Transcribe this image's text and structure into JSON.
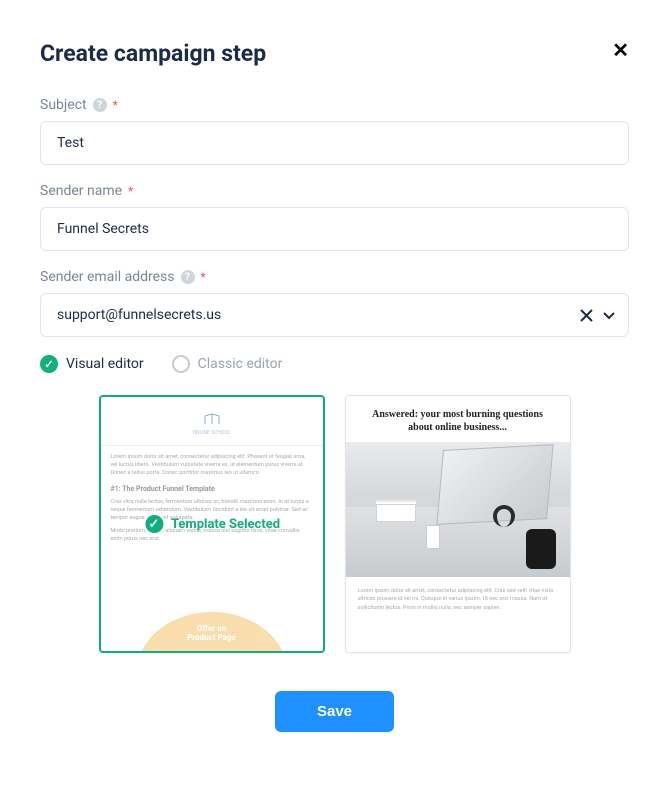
{
  "header": {
    "title": "Create campaign step"
  },
  "fields": {
    "subject": {
      "label": "Subject",
      "value": "Test"
    },
    "sender_name": {
      "label": "Sender name",
      "value": "Funnel Secrets"
    },
    "sender_email": {
      "label": "Sender email address",
      "value": "support@funnelsecrets.us"
    }
  },
  "editor_options": {
    "visual": "Visual editor",
    "classic": "Classic editor",
    "selected": "visual"
  },
  "templates": {
    "selected_badge": "Template Selected",
    "tpl1": {
      "heading": "#1: The Product Funnel Template",
      "offer_line1": "Offer on",
      "offer_line2": "Product Page"
    },
    "tpl2": {
      "title": "Answered: your most burning questions about online business..."
    }
  },
  "buttons": {
    "save": "Save"
  }
}
